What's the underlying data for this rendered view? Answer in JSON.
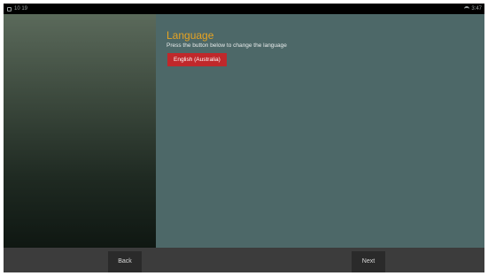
{
  "status_bar": {
    "left_text": "10 19",
    "right_text": "3:47"
  },
  "language_page": {
    "title": "Language",
    "description": "Press the button below to change the language",
    "language_button_label": "English (Australia)"
  },
  "navigation": {
    "back_label": "Back",
    "next_label": "Next"
  },
  "colors": {
    "title_accent": "#e6a322",
    "language_button": "#c0282b",
    "right_panel": "#4d6868",
    "nav_bar": "#3c3c3c"
  },
  "icons": {
    "status_left": "notification-icon",
    "status_right": "wifi-icon"
  }
}
